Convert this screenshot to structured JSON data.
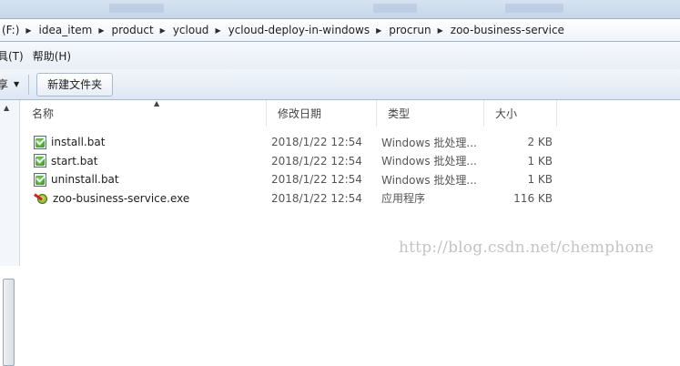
{
  "address_bar": {
    "crumbs": [
      "(F:)",
      "idea_item",
      "product",
      "ycloud",
      "ycloud-deploy-in-windows",
      "procrun",
      "zoo-business-service"
    ]
  },
  "menu": {
    "items": [
      "具(T)",
      "帮助(H)"
    ]
  },
  "toolbar": {
    "share_label": "享",
    "new_folder_label": "新建文件夹"
  },
  "columns": {
    "name": "名称",
    "date": "修改日期",
    "type": "类型",
    "size": "大小"
  },
  "files": [
    {
      "icon": "bat-file-icon",
      "name": "install.bat",
      "date": "2018/1/22 12:54",
      "type": "Windows 批处理...",
      "size": "2 KB"
    },
    {
      "icon": "bat-file-icon",
      "name": "start.bat",
      "date": "2018/1/22 12:54",
      "type": "Windows 批处理...",
      "size": "1 KB"
    },
    {
      "icon": "bat-file-icon",
      "name": "uninstall.bat",
      "date": "2018/1/22 12:54",
      "type": "Windows 批处理...",
      "size": "1 KB"
    },
    {
      "icon": "exe-file-icon",
      "name": "zoo-business-service.exe",
      "date": "2018/1/22 12:54",
      "type": "应用程序",
      "size": "116 KB"
    }
  ],
  "watermark": "http://blog.csdn.net/chemphone",
  "colors": {
    "address_border": "#9fb3cf",
    "toolbar_bg": "#dde7f3",
    "watermark": "#c4c4c4"
  }
}
